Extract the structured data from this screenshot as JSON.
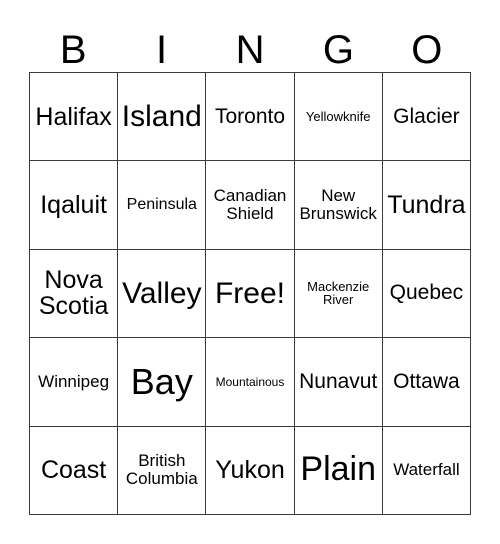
{
  "card": {
    "header_letters": [
      "B",
      "I",
      "N",
      "G",
      "O"
    ],
    "rows": [
      [
        {
          "text": "Halifax",
          "size": "fs-m"
        },
        {
          "text": "Island",
          "size": "fs-l"
        },
        {
          "text": "Toronto",
          "size": "fs-s"
        },
        {
          "text": "Yellowknife",
          "size": "fs-t"
        },
        {
          "text": "Glacier",
          "size": "fs-s"
        }
      ],
      [
        {
          "text": "Iqaluit",
          "size": "fs-m"
        },
        {
          "text": "Peninsula",
          "size": "fs-xxs"
        },
        {
          "text": "Canadian Shield",
          "size": "fs-xs"
        },
        {
          "text": "New Brunswick",
          "size": "fs-xs"
        },
        {
          "text": "Tundra",
          "size": "fs-m"
        }
      ],
      [
        {
          "text": "Nova Scotia",
          "size": "fs-m"
        },
        {
          "text": "Valley",
          "size": "fs-l"
        },
        {
          "text": "Free!",
          "size": "fs-l"
        },
        {
          "text": "Mackenzie River",
          "size": "fs-t"
        },
        {
          "text": "Quebec",
          "size": "fs-s"
        }
      ],
      [
        {
          "text": "Winnipeg",
          "size": "fs-xs"
        },
        {
          "text": "Bay",
          "size": "fs-xxl"
        },
        {
          "text": "Mountainous",
          "size": "fs-tt"
        },
        {
          "text": "Nunavut",
          "size": "fs-s"
        },
        {
          "text": "Ottawa",
          "size": "fs-s"
        }
      ],
      [
        {
          "text": "Coast",
          "size": "fs-m"
        },
        {
          "text": "British Columbia",
          "size": "fs-xs"
        },
        {
          "text": "Yukon",
          "size": "fs-m"
        },
        {
          "text": "Plain",
          "size": "fs-xl"
        },
        {
          "text": "Waterfall",
          "size": "fs-xs"
        }
      ]
    ],
    "free_space_text": "Free!",
    "colors": {
      "background": "#ffffff",
      "text": "#000000",
      "border": "#3b3b3b"
    }
  }
}
